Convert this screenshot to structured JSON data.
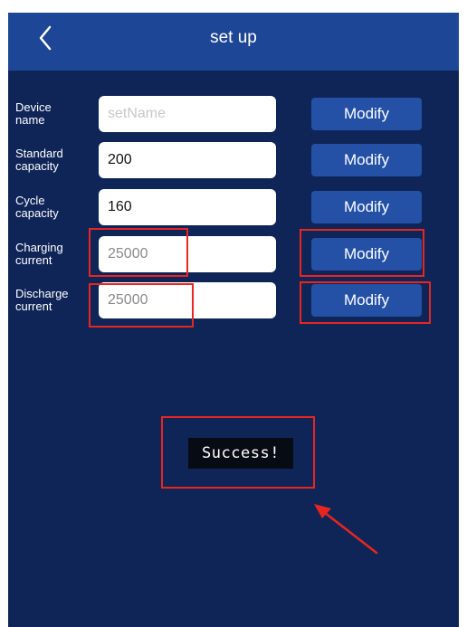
{
  "header": {
    "title": "set up",
    "back_icon": "chevron-left-icon"
  },
  "rows": [
    {
      "label_line1": "Device",
      "label_line2": "name",
      "value": "",
      "placeholder": "setName",
      "button": "Modify"
    },
    {
      "label_line1": "Standard",
      "label_line2": "capacity",
      "value": "200",
      "placeholder": "",
      "button": "Modify"
    },
    {
      "label_line1": "Cycle",
      "label_line2": "capacity",
      "value": "160",
      "placeholder": "",
      "button": "Modify"
    },
    {
      "label_line1": "Charging",
      "label_line2": "current",
      "value": "25000",
      "placeholder": "",
      "button": "Modify"
    },
    {
      "label_line1": "Discharge",
      "label_line2": "current",
      "value": "25000",
      "placeholder": "",
      "button": "Modify"
    }
  ],
  "toast": {
    "message": "Success!"
  },
  "colors": {
    "header": "#1e4696",
    "background": "#0f2557",
    "button": "#2451a6",
    "highlight": "#e8261f"
  }
}
